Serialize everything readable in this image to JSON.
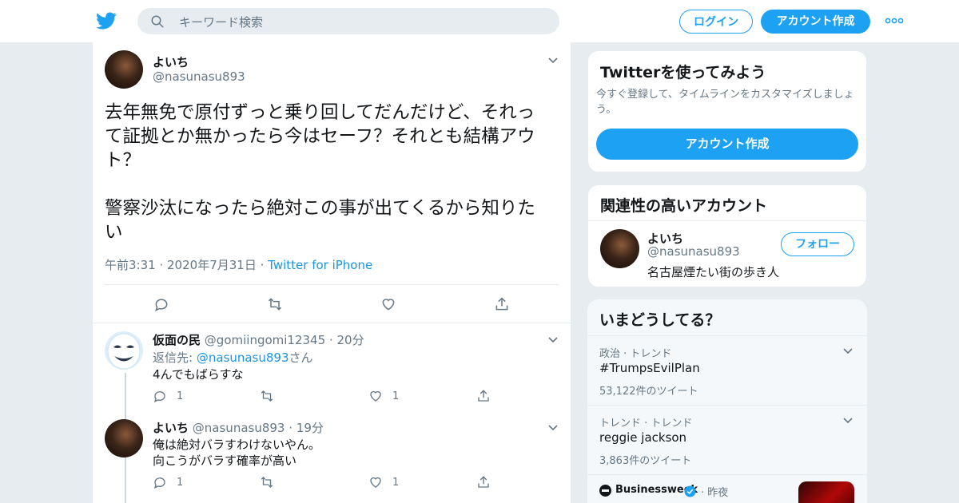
{
  "header": {
    "search_placeholder": "キーワード検索",
    "login_label": "ログイン",
    "signup_label": "アカウント作成"
  },
  "tweet": {
    "name": "よいち",
    "handle": "@nasunasu893",
    "text_line1": "去年無免で原付ずっと乗り回してだんだけど、それっ",
    "text_line2": "て証拠とか無かったら今はセーフ？それとも結構アウ",
    "text_line3": "ト？",
    "text_line4": "警察沙汰になったら絶対この事が出てくるから知りた",
    "text_line5": "い",
    "time": "午前3:31",
    "date": "2020年7月31日",
    "source": "Twitter for iPhone"
  },
  "replies": [
    {
      "name": "仮面の民",
      "handle": "@gomiingomi12345",
      "age": "20分",
      "reply_to_prefix": "返信先: ",
      "reply_to_handle": "@nasunasu893",
      "reply_to_suffix": "さん",
      "text": "4んでもばらすな",
      "reply_count": "1",
      "like_count": "1"
    },
    {
      "name": "よいち",
      "handle": "@nasunasu893",
      "age": "19分",
      "text_line1": "俺は絶対バラすわけないやん。",
      "text_line2": "向こうがバラす確率が高い",
      "reply_count": "1",
      "like_count": "1"
    }
  ],
  "sidebar": {
    "signup_card": {
      "title": "Twitterを使ってみよう",
      "desc_line1": "今すぐ登録して、タイムラインをカスタマイズしましょ",
      "desc_line2": "う。",
      "button": "アカウント作成"
    },
    "related": {
      "title": "関連性の高いアカウント",
      "name": "よいち",
      "handle": "@nasunasu893",
      "bio": "名古屋煙たい街の歩き人",
      "follow": "フォロー"
    },
    "trends": {
      "title": "いまどうしてる？",
      "items": [
        {
          "context": "政治 · トレンド",
          "topic": "#TrumpsEvilPlan",
          "count": "53,122件のツイート"
        },
        {
          "context": "トレンド · トレンド",
          "topic": "reggie jackson",
          "count": "3,863件のツイート"
        }
      ],
      "news": {
        "source": "Businessweek",
        "sep": "·",
        "time": "昨夜"
      }
    }
  },
  "colors": {
    "accent": "#1da1f2",
    "link": "#1b95e0",
    "muted": "#657786",
    "bg": "#e6ecf0"
  }
}
